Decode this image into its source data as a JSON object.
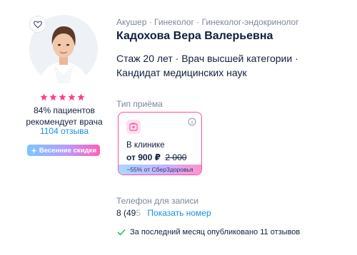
{
  "doctor": {
    "specialties": "Акушер · Гинеколог · Гинеколог-эндокринолог",
    "name": "Кадохова Вера Валерьевна",
    "experience": "Стаж 20 лет · Врач высшей категории · Кандидат медицинских наук"
  },
  "rating": {
    "stars": 5,
    "recommend_line1": "84% пациентов",
    "recommend_line2": "рекомендует врача",
    "reviews_link": "1104 отзыва"
  },
  "badge": {
    "label": "Весенние скидки"
  },
  "visit": {
    "label": "Тип приёма",
    "type": "В клинике",
    "price_now": "от 900 ₽",
    "price_old": "2 000",
    "discount_text": "−55% от СберЗдоровья"
  },
  "phone": {
    "label": "Телефон для записи",
    "number_visible": "8 (49",
    "number_fade": "5",
    "show_button": "Показать номер"
  },
  "published": {
    "text": "За последний месяц опубликовано 11 отзывов"
  },
  "colors": {
    "accent_pink": "#ff4fa3",
    "link_blue": "#1a8fe3",
    "star_pink": "#ff3e8f",
    "check_green": "#2fb86b",
    "muted_text": "#7d8699"
  },
  "icons": {
    "favorite": "heart-icon",
    "clinic": "clinic-icon",
    "info": "info-icon",
    "badge": "sparkle-icon",
    "published": "check-icon"
  }
}
